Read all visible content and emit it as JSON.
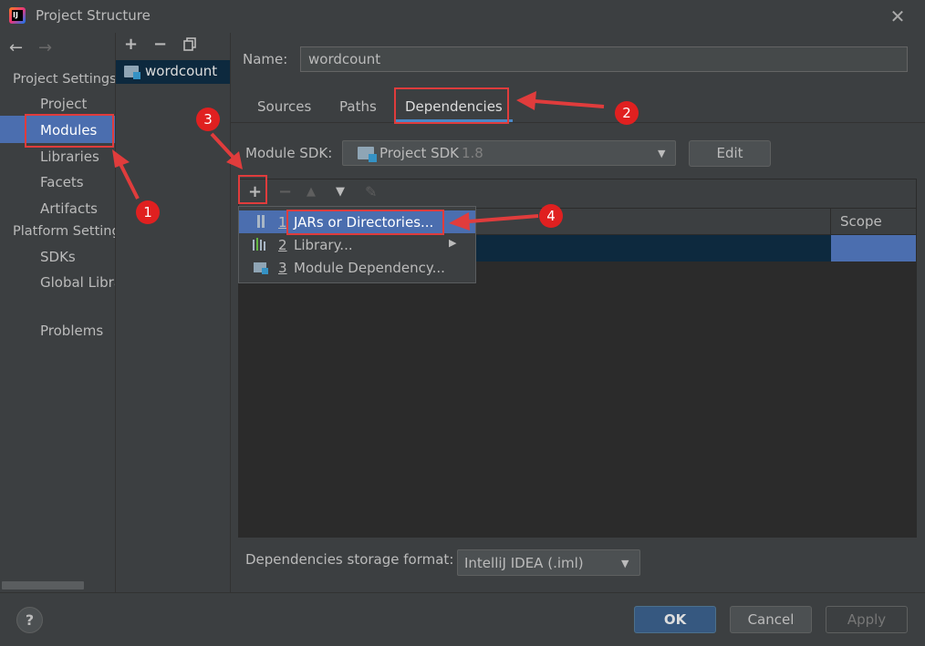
{
  "window": {
    "title": "Project Structure",
    "app_icon_text": "IJ"
  },
  "left_panel": {
    "section_project_settings": "Project Settings",
    "items_project": [
      "Project",
      "Modules",
      "Libraries",
      "Facets",
      "Artifacts"
    ],
    "section_platform_settings": "Platform Settings",
    "items_platform": [
      "SDKs",
      "Global Libraries"
    ],
    "problems": "Problems",
    "selected": "Modules"
  },
  "module_list": {
    "modules": [
      "wordcount"
    ]
  },
  "name_field": {
    "label": "Name:",
    "value": "wordcount"
  },
  "tabs": [
    "Sources",
    "Paths",
    "Dependencies"
  ],
  "active_tab": "Dependencies",
  "module_sdk": {
    "label": "Module SDK:",
    "value": "Project SDK",
    "version": "1.8",
    "edit_label": "Edit"
  },
  "dependencies_table": {
    "scope_header": "Scope"
  },
  "add_menu": {
    "items": [
      {
        "num": "1",
        "label": "JARs or Directories..."
      },
      {
        "num": "2",
        "label": "Library..."
      },
      {
        "num": "3",
        "label": "Module Dependency..."
      }
    ]
  },
  "storage_format": {
    "label": "Dependencies storage format:",
    "value": "IntelliJ IDEA (.iml)"
  },
  "buttons": {
    "ok": "OK",
    "cancel": "Cancel",
    "apply": "Apply",
    "help": "?"
  },
  "annotations": [
    "1",
    "2",
    "3",
    "4"
  ],
  "colors": {
    "selection": "#4b6eaf",
    "annotation_red": "#e03c3c",
    "background": "#3c3f41"
  }
}
